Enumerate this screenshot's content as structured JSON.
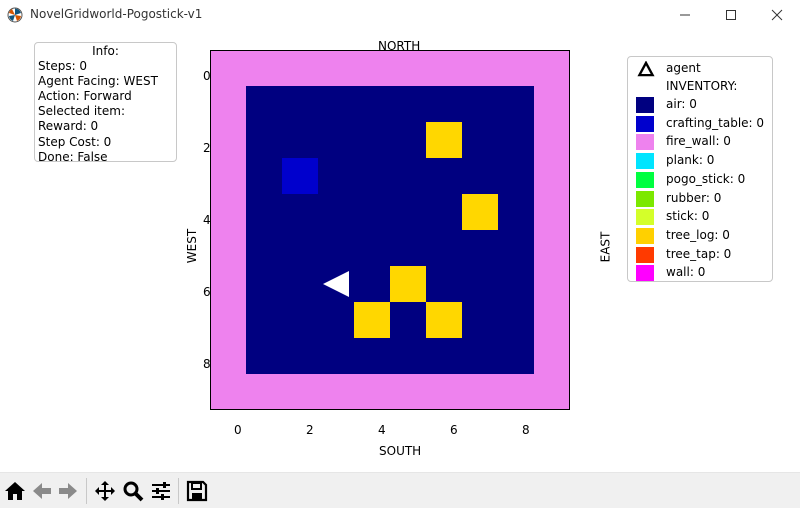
{
  "window": {
    "title": "NovelGridworld-Pogostick-v1",
    "app_icon": "matplotlib-logo-icon",
    "controls": [
      "minimize-icon",
      "maximize-icon",
      "close-icon"
    ]
  },
  "info": {
    "title": "Info:",
    "lines": [
      "Steps: 0",
      "Agent Facing: WEST",
      "Action: Forward",
      "Selected item:",
      "Reward: 0",
      "Step Cost: 0",
      "Done: False"
    ]
  },
  "plot": {
    "top_label": "NORTH",
    "bottom_label": "SOUTH",
    "left_label": "WEST",
    "right_label": "EAST",
    "x_ticks": [
      "0",
      "2",
      "4",
      "6",
      "8"
    ],
    "y_ticks": [
      "0",
      "2",
      "4",
      "6",
      "8"
    ],
    "grid_size": 10,
    "cell_colors": {
      "wall_border": "#EE82EE",
      "air": "#000080",
      "crafting_table": "#0000CD",
      "tree_log": "#FFD700",
      "agent": "#FFFFFF"
    },
    "crafting_tables": [
      [
        2,
        3
      ]
    ],
    "tree_logs": [
      [
        6,
        2
      ],
      [
        7,
        4
      ],
      [
        5,
        6
      ],
      [
        4,
        7
      ],
      [
        6,
        7
      ]
    ],
    "agent": {
      "col": 3,
      "row": 6,
      "facing": "WEST"
    }
  },
  "legend": {
    "agent_label": "agent",
    "inventory_heading": "INVENTORY:",
    "items": [
      {
        "label": "air: 0",
        "color": "#000080"
      },
      {
        "label": "crafting_table: 0",
        "color": "#0000CD"
      },
      {
        "label": "fire_wall: 0",
        "color": "#EE82EE"
      },
      {
        "label": "plank: 0",
        "color": "#00E5FF"
      },
      {
        "label": "pogo_stick: 0",
        "color": "#00FF40"
      },
      {
        "label": "rubber: 0",
        "color": "#7CE800"
      },
      {
        "label": "stick: 0",
        "color": "#D4FF2A"
      },
      {
        "label": "tree_log: 0",
        "color": "#FFD000"
      },
      {
        "label": "tree_tap: 0",
        "color": "#FF3A00"
      },
      {
        "label": "wall: 0",
        "color": "#FF00FF"
      }
    ]
  },
  "toolbar": {
    "buttons": [
      "home-icon",
      "back-arrow-icon",
      "forward-arrow-icon",
      "pan-icon",
      "zoom-icon",
      "configure-subplots-icon",
      "save-icon"
    ]
  }
}
